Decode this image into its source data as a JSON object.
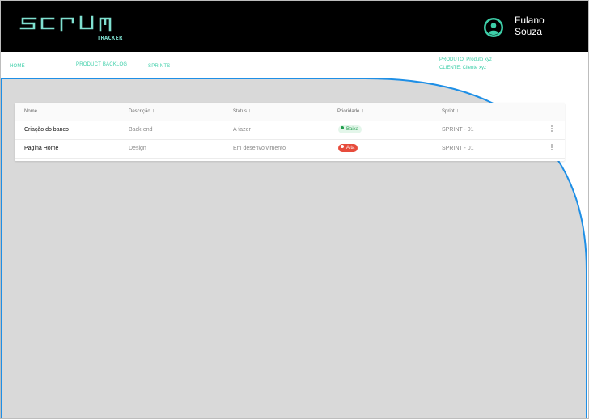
{
  "header": {
    "logo_text": "SCRUM",
    "logo_subtext": "TRACKER",
    "user": {
      "first_name": "Fulano",
      "last_name": "Souza",
      "icon": "user-circle-icon"
    }
  },
  "nav": {
    "home": "HOME",
    "product_backlog": "PRODUCT BACKLOG",
    "sprints": "SPRINTS",
    "produto": "PRODUTO: Produto xyz",
    "cliente": "CLIENTE: Cliente xyz"
  },
  "table": {
    "columns": [
      "Nome",
      "Descrição",
      "Status",
      "Prioridade",
      "Sprint"
    ],
    "sort_icon": "arrow-down-icon",
    "rows": [
      {
        "nome": "Criação do banco",
        "descricao": "Back-end",
        "status": "A fazer",
        "prioridade": "Baixa",
        "sprint": "SPRINT - 01"
      },
      {
        "nome": "Pagina Home",
        "descricao": "Design",
        "status": "Em desenvolvimento",
        "prioridade": "Alta",
        "sprint": "SPRINT - 01"
      }
    ]
  },
  "colors": {
    "header_bg": "#000000",
    "accent": "#3ecfa9",
    "logo": "#7fe0d0",
    "content_bg": "#d9d9d9",
    "outline": "#1e8fe6",
    "badge_low_bg": "#e3f6ea",
    "badge_low_text": "#1f9d4c",
    "badge_high_bg": "#e74c3c",
    "badge_high_text": "#ffffff"
  }
}
